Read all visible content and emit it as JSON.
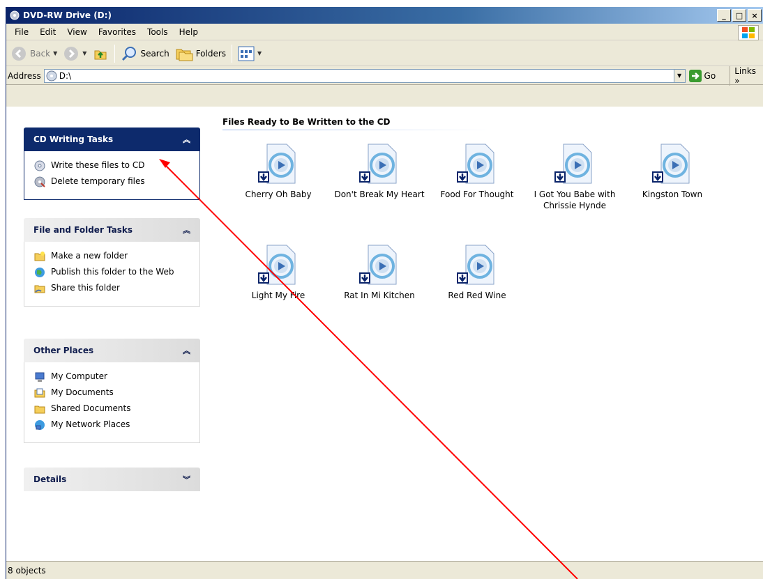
{
  "window": {
    "title": "DVD-RW Drive (D:)",
    "controls": [
      "_",
      "□",
      "×"
    ]
  },
  "menu": [
    "File",
    "Edit",
    "View",
    "Favorites",
    "Tools",
    "Help"
  ],
  "toolbar": {
    "back": "Back",
    "search": "Search",
    "folders": "Folders"
  },
  "address": {
    "label": "Address",
    "value": "D:\\",
    "go": "Go",
    "links": "Links"
  },
  "taskpane": {
    "cd_tasks": {
      "title": "CD Writing Tasks",
      "items": [
        "Write these files to CD",
        "Delete temporary files"
      ]
    },
    "file_tasks": {
      "title": "File and Folder Tasks",
      "items": [
        "Make a new folder",
        "Publish this folder to the Web",
        "Share this folder"
      ]
    },
    "other_places": {
      "title": "Other Places",
      "items": [
        "My Computer",
        "My Documents",
        "Shared Documents",
        "My Network Places"
      ]
    },
    "details": {
      "title": "Details"
    }
  },
  "files": {
    "section_title": "Files Ready to Be Written to the CD",
    "items": [
      "Cherry Oh Baby",
      "Don't Break My Heart",
      "Food For Thought",
      "I Got You Babe with Chrissie Hynde",
      "Kingston Town",
      "Light My Fire",
      "Rat In Mi Kitchen",
      "Red Red Wine"
    ]
  },
  "status": {
    "text": "8 objects"
  },
  "colors": {
    "annotation": "#ff0000",
    "panel_dark": "#0d2a6c"
  }
}
